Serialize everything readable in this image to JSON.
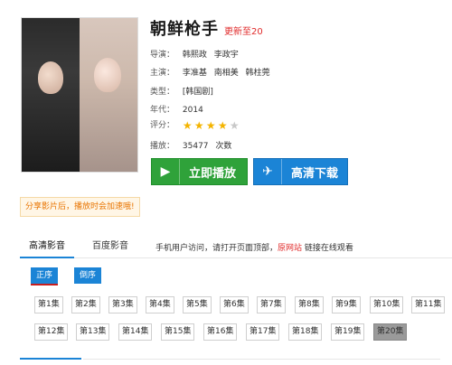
{
  "show": {
    "title": "朝鲜枪手",
    "update_status": "更新至20",
    "director_label": "导演：",
    "director": [
      "韩熙政",
      "李政宇"
    ],
    "cast_label": "主演：",
    "cast": [
      "李准基",
      "南相美",
      "韩柱莞"
    ],
    "genre_label": "类型：",
    "genre": "[韩国剧]",
    "year_label": "年代：",
    "year": "2014",
    "rating_label": "评分：",
    "rating_stars": 4,
    "rating_max": 5,
    "plays_label": "播放：",
    "plays": "35477",
    "plays_unit": "次数"
  },
  "actions": {
    "play_label": "立即播放",
    "download_label": "高清下载",
    "play_icon": "play-icon",
    "download_icon": "bird-icon"
  },
  "share_note": "分享影片后，播放时会加速哦!",
  "tabs": {
    "items": [
      "高清影音",
      "百度影音"
    ],
    "active": "高清影音",
    "notice_prefix": "手机用户访问，请打开页面顶部，",
    "notice_link": "原网站",
    "notice_suffix": " 链接在线观看"
  },
  "sort": {
    "asc_label": "正序",
    "desc_label": "倒序"
  },
  "episodes": [
    "第1集",
    "第2集",
    "第3集",
    "第4集",
    "第5集",
    "第6集",
    "第7集",
    "第8集",
    "第9集",
    "第10集",
    "第11集",
    "第12集",
    "第13集",
    "第14集",
    "第15集",
    "第16集",
    "第17集",
    "第18集",
    "第19集",
    "第20集"
  ],
  "current_episode": "第20集",
  "colors": {
    "play_green": "#2fa23a",
    "download_blue": "#1b84d6",
    "accent_red": "#e02a2a",
    "share_orange": "#e87400",
    "star_gold": "#f4b400"
  }
}
